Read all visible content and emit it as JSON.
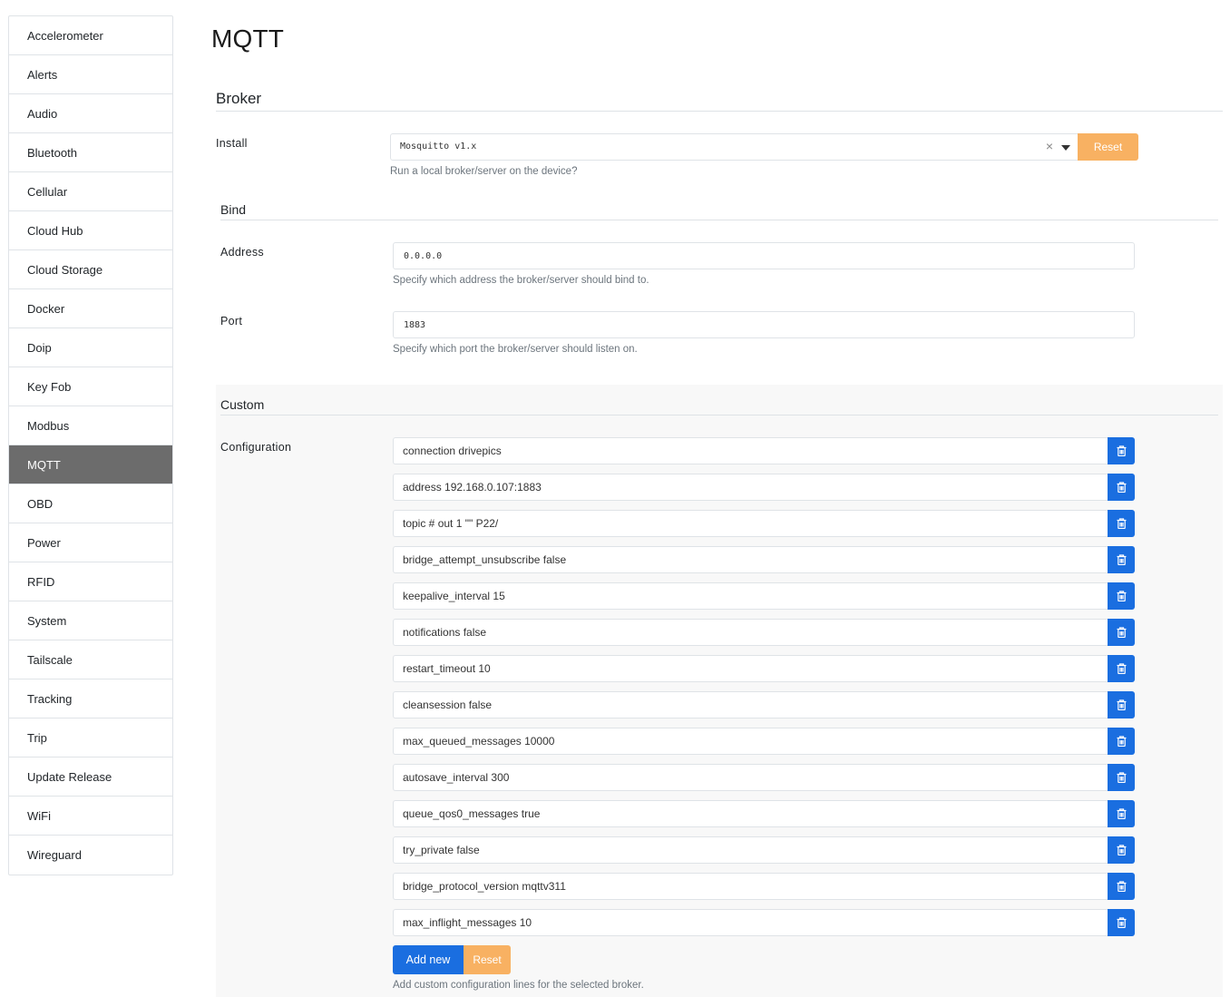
{
  "sidebar": {
    "items": [
      {
        "label": "Accelerometer"
      },
      {
        "label": "Alerts"
      },
      {
        "label": "Audio"
      },
      {
        "label": "Bluetooth"
      },
      {
        "label": "Cellular"
      },
      {
        "label": "Cloud Hub"
      },
      {
        "label": "Cloud Storage"
      },
      {
        "label": "Docker"
      },
      {
        "label": "Doip"
      },
      {
        "label": "Key Fob"
      },
      {
        "label": "Modbus"
      },
      {
        "label": "MQTT"
      },
      {
        "label": "OBD"
      },
      {
        "label": "Power"
      },
      {
        "label": "RFID"
      },
      {
        "label": "System"
      },
      {
        "label": "Tailscale"
      },
      {
        "label": "Tracking"
      },
      {
        "label": "Trip"
      },
      {
        "label": "Update Release"
      },
      {
        "label": "WiFi"
      },
      {
        "label": "Wireguard"
      }
    ],
    "active": "MQTT"
  },
  "page": {
    "title": "MQTT"
  },
  "broker": {
    "heading": "Broker",
    "install": {
      "label": "Install",
      "value": "Mosquitto v1.x",
      "clear_glyph": "×",
      "reset_label": "Reset",
      "help": "Run a local broker/server on the device?"
    }
  },
  "bind": {
    "heading": "Bind",
    "address": {
      "label": "Address",
      "value": "0.0.0.0",
      "help": "Specify which address the broker/server should bind to."
    },
    "port": {
      "label": "Port",
      "value": "1883",
      "help": "Specify which port the broker/server should listen on."
    }
  },
  "custom": {
    "heading": "Custom",
    "configuration": {
      "label": "Configuration",
      "lines": [
        "connection drivepics",
        "address 192.168.0.107:1883",
        "topic # out 1 \"\" P22/",
        "bridge_attempt_unsubscribe false",
        "keepalive_interval 15",
        "notifications false",
        "restart_timeout 10",
        "cleansession false",
        "max_queued_messages 10000",
        "autosave_interval 300",
        "queue_qos0_messages true",
        "try_private false",
        "bridge_protocol_version mqttv311",
        "max_inflight_messages 10"
      ],
      "add_label": "Add new",
      "reset_label": "Reset",
      "help": "Add custom configuration lines for the selected broker."
    }
  },
  "colors": {
    "active_nav": "#6c6c6c",
    "primary": "#1a6ee0",
    "warning": "#f8b162"
  }
}
